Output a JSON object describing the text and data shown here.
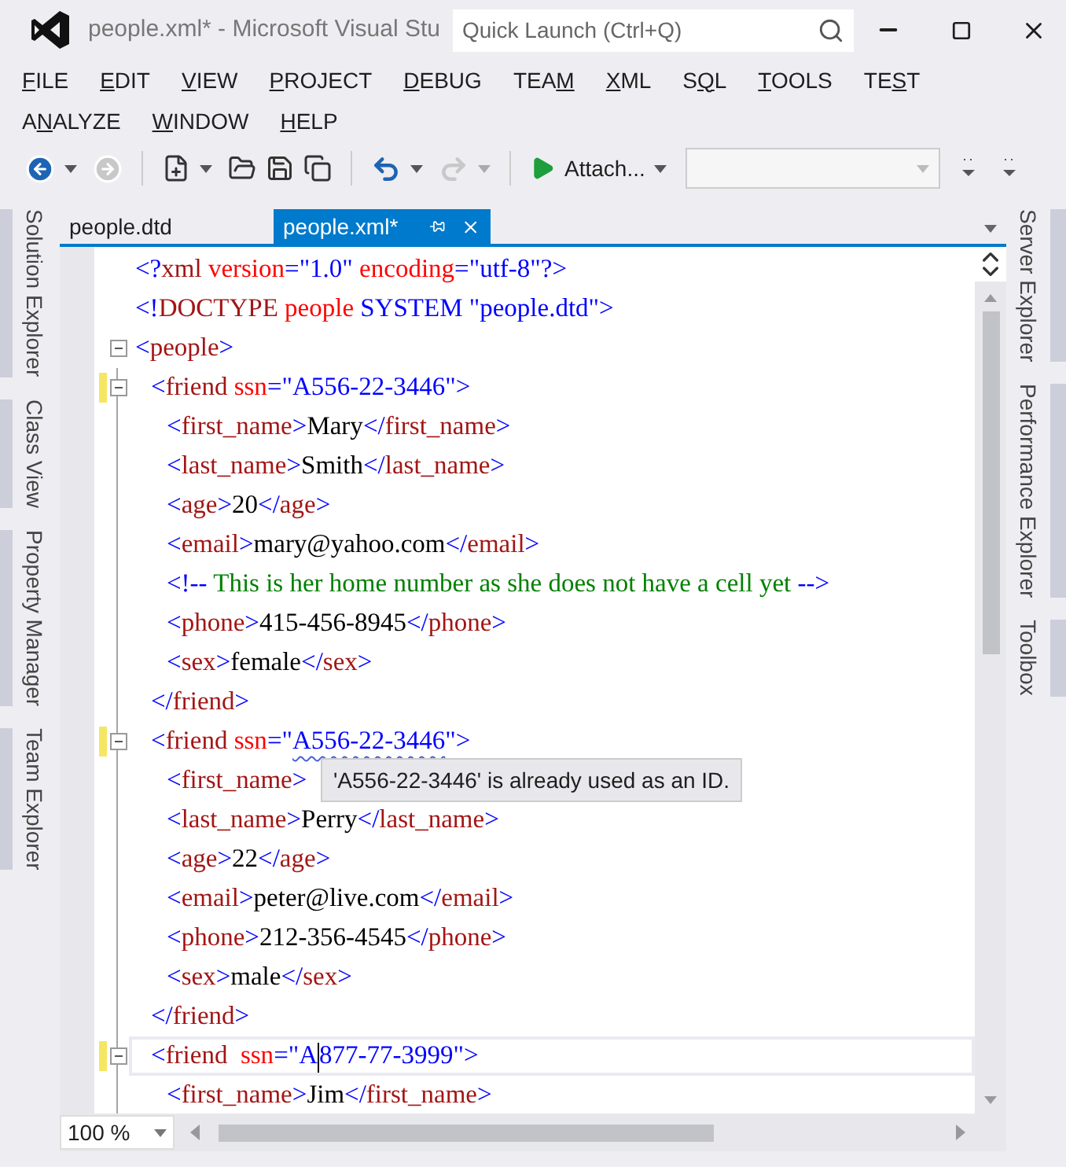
{
  "window": {
    "title": "people.xml* - Microsoft Visual Stu",
    "quick_launch": {
      "placeholder": "Quick Launch (Ctrl+Q)"
    }
  },
  "menu": [
    {
      "key": "F",
      "after": "ILE"
    },
    {
      "key": "E",
      "after": "DIT"
    },
    {
      "key": "V",
      "after": "IEW"
    },
    {
      "key": "P",
      "after": "ROJECT"
    },
    {
      "key": "D",
      "after": "EBUG"
    },
    {
      "before": "TEA",
      "key": "M"
    },
    {
      "key": "X",
      "after": "ML"
    },
    {
      "before": "S",
      "key": "Q",
      "after": "L"
    },
    {
      "key": "T",
      "after": "OOLS"
    },
    {
      "before": "TE",
      "key": "S",
      "after": "T"
    },
    {
      "before": "A",
      "key": "N",
      "after": "ALYZE"
    },
    {
      "key": "W",
      "after": "INDOW"
    },
    {
      "key": "H",
      "after": "ELP"
    }
  ],
  "toolbar": {
    "attach": "Attach..."
  },
  "left_panels": [
    {
      "label": "Solution Explorer"
    },
    {
      "label": "Class View"
    },
    {
      "label": "Property Manager"
    },
    {
      "label": "Team Explorer"
    }
  ],
  "right_panels": [
    {
      "label": "Server Explorer"
    },
    {
      "label": "Performance Explorer"
    },
    {
      "label": "Toolbox"
    }
  ],
  "tabs": [
    {
      "label": "people.dtd",
      "selected": false
    },
    {
      "label": "people.xml*",
      "selected": true
    }
  ],
  "code": [
    {
      "changed": false,
      "current": false,
      "tokens": [
        {
          "kind": "p",
          "t": "<?"
        },
        {
          "kind": "tag",
          "t": "xml"
        },
        {
          "kind": "attr",
          "t": " version"
        },
        {
          "kind": "p",
          "t": "=\"1.0\""
        },
        {
          "kind": "attr",
          "t": " encoding"
        },
        {
          "kind": "p",
          "t": "=\"utf-8\"?>"
        }
      ]
    },
    {
      "changed": false,
      "current": false,
      "tokens": [
        {
          "kind": "p",
          "t": "<!"
        },
        {
          "kind": "tag",
          "t": "DOCTYPE"
        },
        {
          "kind": "attr",
          "t": " people"
        },
        {
          "kind": "p",
          "t": " SYSTEM \"people.dtd\">"
        }
      ]
    },
    {
      "changed": false,
      "current": false,
      "tokens": [
        {
          "kind": "p",
          "t": "<"
        },
        {
          "kind": "tag",
          "t": "people"
        },
        {
          "kind": "p",
          "t": ">"
        }
      ],
      "children": [
        {
          "changed": true,
          "current": false,
          "tokens": [
            {
              "kind": "p",
              "t": "<"
            },
            {
              "kind": "tag",
              "t": "friend"
            },
            {
              "kind": "attr",
              "t": " ssn"
            },
            {
              "kind": "p",
              "t": "=\"A556-22-3446\">"
            }
          ],
          "children": [
            {
              "changed": false,
              "current": false,
              "tokens": [
                {
                  "kind": "p",
                  "t": "<"
                },
                {
                  "kind": "tag",
                  "t": "first_name"
                },
                {
                  "kind": "p",
                  "t": ">"
                },
                {
                  "kind": "txt",
                  "t": "Mary"
                },
                {
                  "kind": "p",
                  "t": "</"
                },
                {
                  "kind": "tag",
                  "t": "first_name"
                },
                {
                  "kind": "p",
                  "t": ">"
                }
              ]
            },
            {
              "changed": false,
              "current": false,
              "tokens": [
                {
                  "kind": "p",
                  "t": "<"
                },
                {
                  "kind": "tag",
                  "t": "last_name"
                },
                {
                  "kind": "p",
                  "t": ">"
                },
                {
                  "kind": "txt",
                  "t": "Smith"
                },
                {
                  "kind": "p",
                  "t": "</"
                },
                {
                  "kind": "tag",
                  "t": "last_name"
                },
                {
                  "kind": "p",
                  "t": ">"
                }
              ]
            },
            {
              "changed": false,
              "current": false,
              "tokens": [
                {
                  "kind": "p",
                  "t": "<"
                },
                {
                  "kind": "tag",
                  "t": "age"
                },
                {
                  "kind": "p",
                  "t": ">"
                },
                {
                  "kind": "txt",
                  "t": "20"
                },
                {
                  "kind": "p",
                  "t": "</"
                },
                {
                  "kind": "tag",
                  "t": "age"
                },
                {
                  "kind": "p",
                  "t": ">"
                }
              ]
            },
            {
              "changed": false,
              "current": false,
              "tokens": [
                {
                  "kind": "p",
                  "t": "<"
                },
                {
                  "kind": "tag",
                  "t": "email"
                },
                {
                  "kind": "p",
                  "t": ">"
                },
                {
                  "kind": "txt",
                  "t": "mary@yahoo.com"
                },
                {
                  "kind": "p",
                  "t": "</"
                },
                {
                  "kind": "tag",
                  "t": "email"
                },
                {
                  "kind": "p",
                  "t": ">"
                }
              ]
            },
            {
              "changed": false,
              "current": false,
              "tokens": [
                {
                  "kind": "p",
                  "t": "<!--"
                },
                {
                  "kind": "cmt",
                  "t": " This is her home number as she does not have a cell yet "
                },
                {
                  "kind": "p",
                  "t": "-->"
                }
              ]
            },
            {
              "changed": false,
              "current": false,
              "tokens": [
                {
                  "kind": "p",
                  "t": "<"
                },
                {
                  "kind": "tag",
                  "t": "phone"
                },
                {
                  "kind": "p",
                  "t": ">"
                },
                {
                  "kind": "txt",
                  "t": "415-456-8945"
                },
                {
                  "kind": "p",
                  "t": "</"
                },
                {
                  "kind": "tag",
                  "t": "phone"
                },
                {
                  "kind": "p",
                  "t": ">"
                }
              ]
            },
            {
              "changed": false,
              "current": false,
              "tokens": [
                {
                  "kind": "p",
                  "t": "<"
                },
                {
                  "kind": "tag",
                  "t": "sex"
                },
                {
                  "kind": "p",
                  "t": ">"
                },
                {
                  "kind": "txt",
                  "t": "female"
                },
                {
                  "kind": "p",
                  "t": "</"
                },
                {
                  "kind": "tag",
                  "t": "sex"
                },
                {
                  "kind": "p",
                  "t": ">"
                }
              ]
            }
          ]
        },
        {
          "changed": false,
          "current": false,
          "tokens": [
            {
              "kind": "p",
              "t": "</"
            },
            {
              "kind": "tag",
              "t": "friend"
            },
            {
              "kind": "p",
              "t": ">"
            }
          ]
        },
        {
          "changed": true,
          "current": false,
          "tokens": [
            {
              "kind": "p",
              "t": "<"
            },
            {
              "kind": "tag",
              "t": "friend"
            },
            {
              "kind": "attr",
              "t": " ssn"
            },
            {
              "kind": "p",
              "t": "=\""
            },
            {
              "kind": "err",
              "t": "A556-22-3446"
            },
            {
              "kind": "p",
              "t": "\">"
            }
          ],
          "children": [
            {
              "changed": false,
              "current": false,
              "tokens": [
                {
                  "kind": "p",
                  "t": "<"
                },
                {
                  "kind": "tag",
                  "t": "first_name"
                },
                {
                  "kind": "p",
                  "t": ">"
                }
              ]
            },
            {
              "changed": false,
              "current": false,
              "tokens": [
                {
                  "kind": "p",
                  "t": "<"
                },
                {
                  "kind": "tag",
                  "t": "last_name"
                },
                {
                  "kind": "p",
                  "t": ">"
                },
                {
                  "kind": "txt",
                  "t": "Perry"
                },
                {
                  "kind": "p",
                  "t": "</"
                },
                {
                  "kind": "tag",
                  "t": "last_name"
                },
                {
                  "kind": "p",
                  "t": ">"
                }
              ]
            },
            {
              "changed": false,
              "current": false,
              "tokens": [
                {
                  "kind": "p",
                  "t": "<"
                },
                {
                  "kind": "tag",
                  "t": "age"
                },
                {
                  "kind": "p",
                  "t": ">"
                },
                {
                  "kind": "txt",
                  "t": "22"
                },
                {
                  "kind": "p",
                  "t": "</"
                },
                {
                  "kind": "tag",
                  "t": "age"
                },
                {
                  "kind": "p",
                  "t": ">"
                }
              ]
            },
            {
              "changed": false,
              "current": false,
              "tokens": [
                {
                  "kind": "p",
                  "t": "<"
                },
                {
                  "kind": "tag",
                  "t": "email"
                },
                {
                  "kind": "p",
                  "t": ">"
                },
                {
                  "kind": "txt",
                  "t": "peter@live.com"
                },
                {
                  "kind": "p",
                  "t": "</"
                },
                {
                  "kind": "tag",
                  "t": "email"
                },
                {
                  "kind": "p",
                  "t": ">"
                }
              ]
            },
            {
              "changed": false,
              "current": false,
              "tokens": [
                {
                  "kind": "p",
                  "t": "<"
                },
                {
                  "kind": "tag",
                  "t": "phone"
                },
                {
                  "kind": "p",
                  "t": ">"
                },
                {
                  "kind": "txt",
                  "t": "212-356-4545"
                },
                {
                  "kind": "p",
                  "t": "</"
                },
                {
                  "kind": "tag",
                  "t": "phone"
                },
                {
                  "kind": "p",
                  "t": ">"
                }
              ]
            },
            {
              "changed": false,
              "current": false,
              "tokens": [
                {
                  "kind": "p",
                  "t": "<"
                },
                {
                  "kind": "tag",
                  "t": "sex"
                },
                {
                  "kind": "p",
                  "t": ">"
                },
                {
                  "kind": "txt",
                  "t": "male"
                },
                {
                  "kind": "p",
                  "t": "</"
                },
                {
                  "kind": "tag",
                  "t": "sex"
                },
                {
                  "kind": "p",
                  "t": ">"
                }
              ]
            }
          ]
        },
        {
          "changed": false,
          "current": false,
          "tokens": [
            {
              "kind": "p",
              "t": "</"
            },
            {
              "kind": "tag",
              "t": "friend"
            },
            {
              "kind": "p",
              "t": ">"
            }
          ]
        },
        {
          "changed": true,
          "current": true,
          "tokens": [
            {
              "kind": "p",
              "t": "<"
            },
            {
              "kind": "tag",
              "t": "friend"
            },
            {
              "kind": "attr",
              "t": "  ssn"
            },
            {
              "kind": "p",
              "t": "=\"A"
            },
            {
              "kind": "caret"
            },
            {
              "kind": "p",
              "t": "877-77-3999\">"
            }
          ],
          "children": [
            {
              "changed": false,
              "current": false,
              "tokens": [
                {
                  "kind": "p",
                  "t": "<"
                },
                {
                  "kind": "tag",
                  "t": "first_name"
                },
                {
                  "kind": "p",
                  "t": ">"
                },
                {
                  "kind": "txt",
                  "t": "Jim"
                },
                {
                  "kind": "p",
                  "t": "</"
                },
                {
                  "kind": "tag",
                  "t": "first_name"
                },
                {
                  "kind": "p",
                  "t": ">"
                }
              ]
            }
          ]
        }
      ]
    }
  ],
  "tooltip": "'A556-22-3446' is already used as an ID.",
  "zoom": "100 %"
}
